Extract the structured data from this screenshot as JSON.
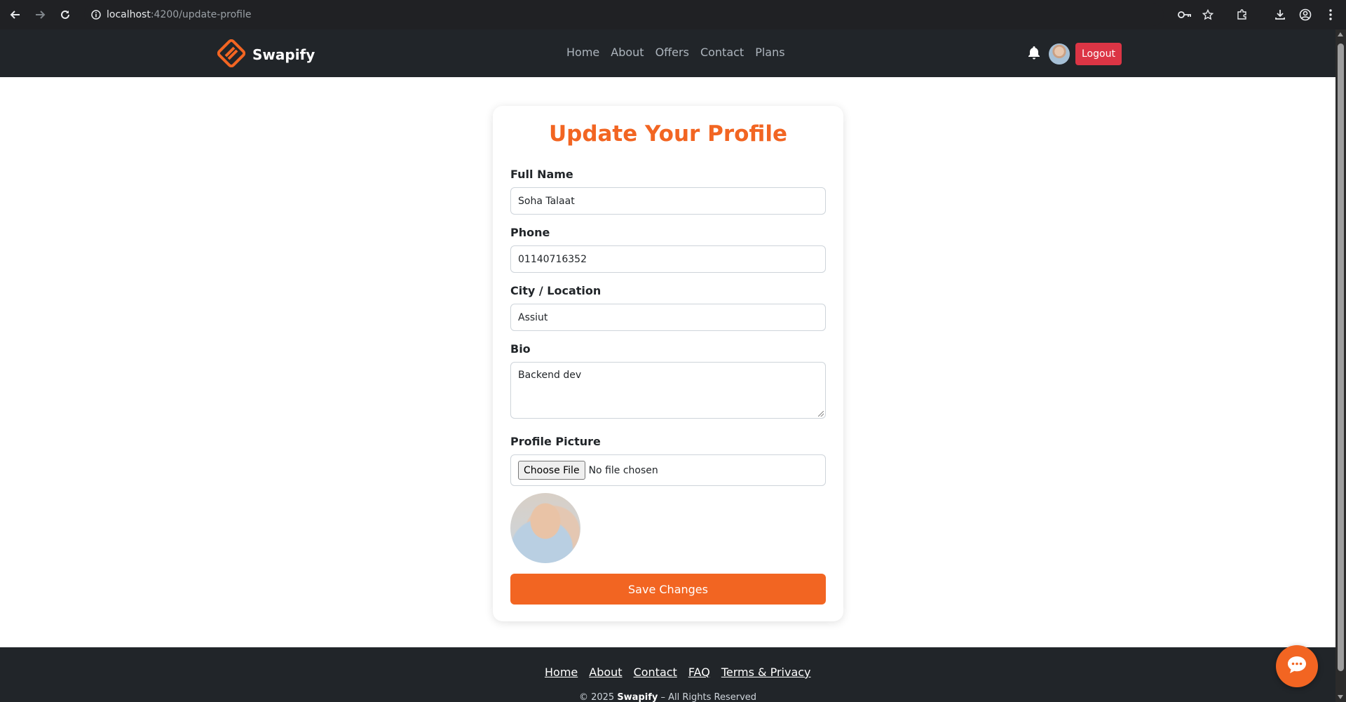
{
  "browser": {
    "url_host": "localhost",
    "url_path": ":4200/update-profile",
    "icons": [
      "back-icon",
      "forward-icon",
      "reload-icon",
      "site-info-icon",
      "key-icon",
      "star-icon",
      "extensions-icon",
      "download-icon",
      "account-icon",
      "more-icon"
    ]
  },
  "navbar": {
    "brand": "Swapify",
    "links": [
      "Home",
      "About",
      "Offers",
      "Contact",
      "Plans"
    ],
    "logout_label": "Logout",
    "logout_color": "#dc3545"
  },
  "form": {
    "title": "Update Your Profile",
    "accent_color": "#f26522",
    "fields": {
      "full_name": {
        "label": "Full Name",
        "value": "Soha Talaat"
      },
      "phone": {
        "label": "Phone",
        "value": "01140716352"
      },
      "city": {
        "label": "City / Location",
        "value": "Assiut"
      },
      "bio": {
        "label": "Bio",
        "value": "Backend dev"
      },
      "picture": {
        "label": "Profile Picture",
        "button": "Choose File",
        "status": "No file chosen"
      }
    },
    "save_label": "Save Changes"
  },
  "footer": {
    "links": [
      "Home",
      "About",
      "Contact",
      "FAQ",
      "Terms & Privacy"
    ],
    "copyright_prefix": "© 2025 ",
    "copyright_brand": "Swapify",
    "copyright_suffix": " – All Rights Reserved"
  }
}
